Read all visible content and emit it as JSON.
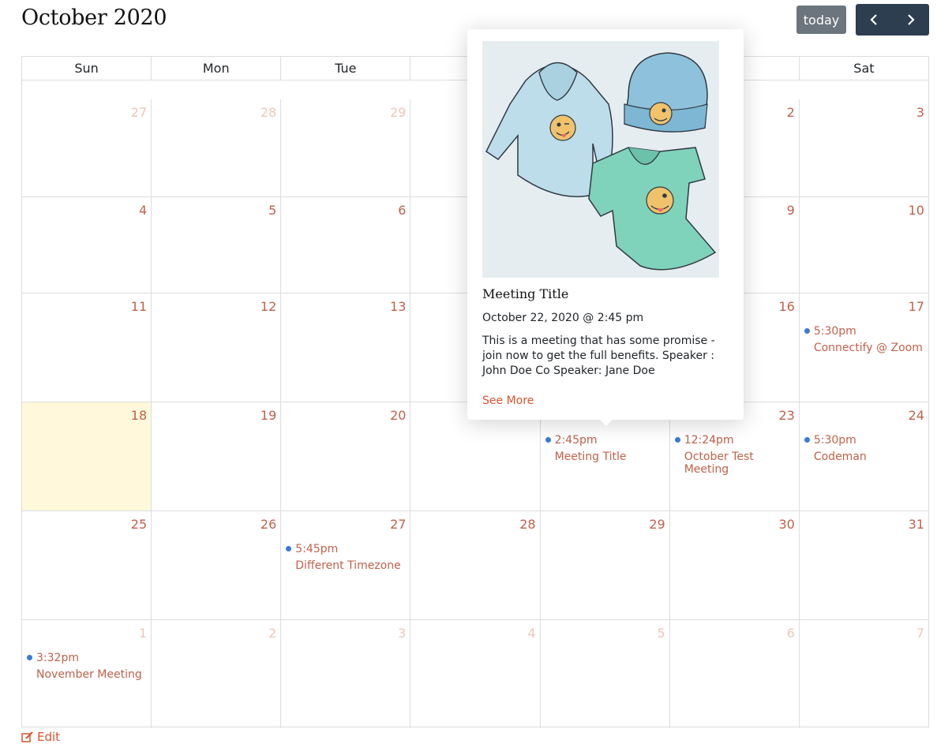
{
  "header": {
    "title": "October 2020",
    "today_label": "today"
  },
  "calendar": {
    "weekdays": [
      "Sun",
      "Mon",
      "Tue",
      "W",
      "",
      "",
      "Sat"
    ],
    "weeks": [
      [
        {
          "n": "27",
          "other": true
        },
        {
          "n": "28",
          "other": true
        },
        {
          "n": "29",
          "other": true
        },
        {
          "n": "",
          "other": true
        },
        {
          "n": "",
          "other": false
        },
        {
          "n": "2",
          "other": false
        },
        {
          "n": "3",
          "other": false
        }
      ],
      [
        {
          "n": "4"
        },
        {
          "n": "5"
        },
        {
          "n": "6"
        },
        {
          "n": ""
        },
        {
          "n": ""
        },
        {
          "n": "9"
        },
        {
          "n": "10"
        }
      ],
      [
        {
          "n": "11"
        },
        {
          "n": "12"
        },
        {
          "n": "13"
        },
        {
          "n": ""
        },
        {
          "n": ""
        },
        {
          "n": "16"
        },
        {
          "n": "17"
        }
      ],
      [
        {
          "n": "18"
        },
        {
          "n": "19"
        },
        {
          "n": "20"
        },
        {
          "n": ""
        },
        {
          "n": ""
        },
        {
          "n": "23"
        },
        {
          "n": "24"
        }
      ],
      [
        {
          "n": "25"
        },
        {
          "n": "26"
        },
        {
          "n": "27"
        },
        {
          "n": "28"
        },
        {
          "n": "29"
        },
        {
          "n": "30"
        },
        {
          "n": "31"
        }
      ],
      [
        {
          "n": "1",
          "other": true
        },
        {
          "n": "2",
          "other": true
        },
        {
          "n": "3",
          "other": true
        },
        {
          "n": "4",
          "other": true
        },
        {
          "n": "5",
          "other": true
        },
        {
          "n": "6",
          "other": true
        },
        {
          "n": "7",
          "other": true
        }
      ]
    ],
    "today_cell": "18",
    "events": [
      {
        "week": 2,
        "day": 6,
        "time": "5:30pm",
        "title": "Connectify @ Zoom"
      },
      {
        "week": 3,
        "day": 4,
        "time": "2:45pm",
        "title": "Meeting Title"
      },
      {
        "week": 3,
        "day": 5,
        "time": "12:24pm",
        "title": "October Test Meeting"
      },
      {
        "week": 3,
        "day": 6,
        "time": "5:30pm",
        "title": "Codeman"
      },
      {
        "week": 4,
        "day": 2,
        "time": "5:45pm",
        "title": "Different Timezone"
      },
      {
        "week": 5,
        "day": 0,
        "time": "3:32pm",
        "title": "November Meeting"
      }
    ]
  },
  "popover": {
    "title": "Meeting Title",
    "date": "October 22, 2020 @ 2:45 pm",
    "description": "This is a meeting that has some promise - join now to get the full benefits. Speaker : John Doe Co Speaker: Jane Doe",
    "link_label": "See More"
  },
  "footer": {
    "edit_label": "Edit"
  },
  "colors": {
    "accent": "#c0614a",
    "link": "#d9532c",
    "today_bg": "#fff8db",
    "event_dot": "#3a7bd5",
    "nav_bg": "#2c3e50",
    "today_btn_bg": "#6c757d"
  },
  "icons": [
    "chevron-left-icon",
    "chevron-right-icon",
    "edit-icon",
    "dot-icon"
  ]
}
